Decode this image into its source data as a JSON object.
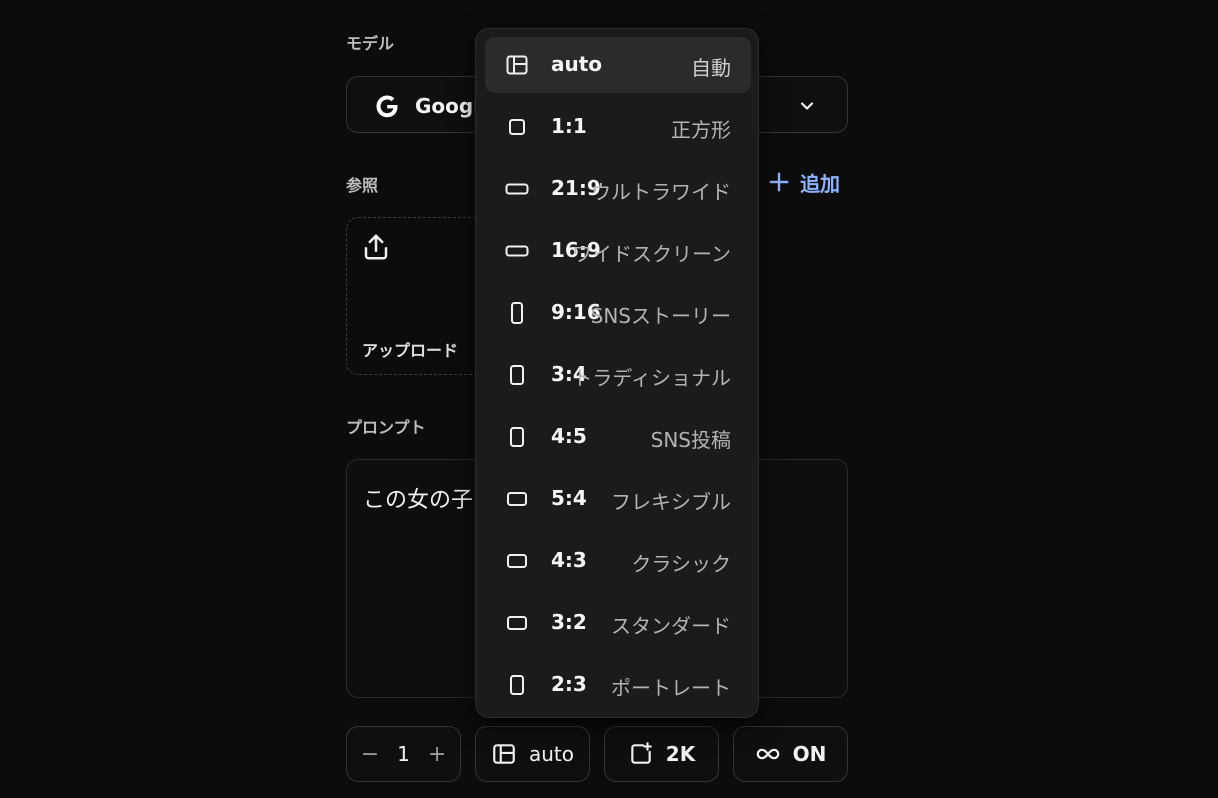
{
  "form": {
    "model_label": "モデル",
    "model_value": "Google",
    "reference_label": "参照",
    "add_label": "追加",
    "upload_label": "アップロード",
    "prompt_label": "プロンプト",
    "prompt_value": "この女の子"
  },
  "toolbar": {
    "count_minus": "−",
    "count_value": "1",
    "count_plus": "+",
    "ratio_value": "auto",
    "resolution_value": "2K",
    "loop_value": "ON"
  },
  "dropdown": {
    "options": [
      {
        "ratio": "auto",
        "desc": "自動",
        "icon": "auto-ratio-icon",
        "selected": true
      },
      {
        "ratio": "1:1",
        "desc": "正方形",
        "icon": "square-icon"
      },
      {
        "ratio": "21:9",
        "desc": "ウルトラワイド",
        "icon": "landscape-icon"
      },
      {
        "ratio": "16:9",
        "desc": "ワイドスクリーン",
        "icon": "landscape-icon"
      },
      {
        "ratio": "9:16",
        "desc": "SNSストーリー",
        "icon": "portrait-icon"
      },
      {
        "ratio": "3:4",
        "desc": "トラディショナル",
        "icon": "portrait-icon"
      },
      {
        "ratio": "4:5",
        "desc": "SNS投稿",
        "icon": "portrait-icon"
      },
      {
        "ratio": "5:4",
        "desc": "フレキシブル",
        "icon": "landscape-icon"
      },
      {
        "ratio": "4:3",
        "desc": "クラシック",
        "icon": "landscape-icon"
      },
      {
        "ratio": "3:2",
        "desc": "スタンダード",
        "icon": "landscape-icon"
      },
      {
        "ratio": "2:3",
        "desc": "ポートレート",
        "icon": "portrait-icon"
      }
    ]
  },
  "colors": {
    "background": "#0c0c0c",
    "dropdown_bg": "#1b1b1b",
    "selected_bg": "#2b2b2b",
    "accent": "#8fb4ff"
  }
}
